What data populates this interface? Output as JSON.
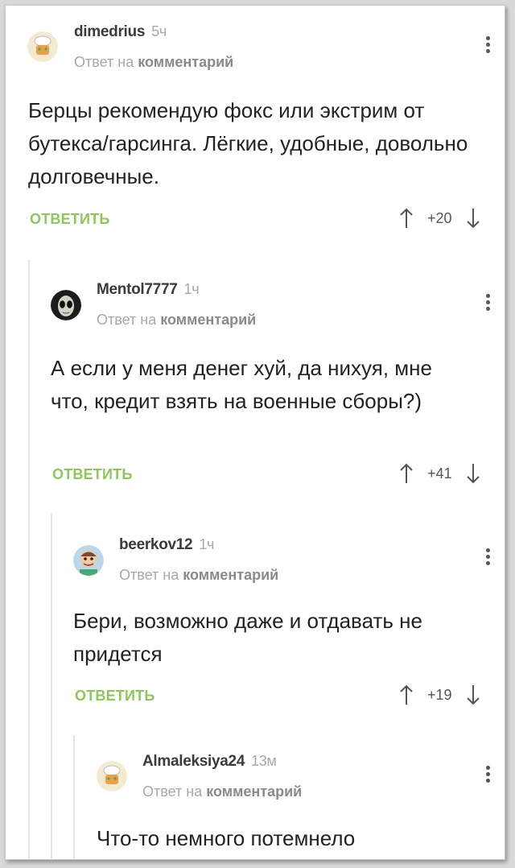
{
  "reply_prefix": "Ответ на",
  "reply_target": "комментарий",
  "reply_button": "ОТВЕТИТЬ",
  "colors": {
    "accent_green": "#8ac858",
    "muted": "#a8a8a8",
    "text": "#222222"
  },
  "comments": [
    {
      "author": "dimedrius",
      "time": "5ч",
      "body": "Берцы рекомендую фокс или экстрим от бутекса/гарсинга. Лёгкие, удобные, довольно долговечные.",
      "score": "+20",
      "avatar": "chef-avatar-icon"
    },
    {
      "author": "Mentol7777",
      "time": "1ч",
      "body": "А если у меня денег хуй, да нихуя, мне что, кредит взять на военные сборы?)",
      "score": "+41",
      "avatar": "alien-avatar-icon"
    },
    {
      "author": "beerkov12",
      "time": "1ч",
      "body": "Бери, возможно даже и отдавать не придется",
      "score": "+19",
      "avatar": "cartoon-avatar-icon"
    },
    {
      "author": "Almaleksiya24",
      "time": "13м",
      "body": "Что-то немного потемнело",
      "score": "",
      "avatar": "chef-avatar-icon"
    }
  ]
}
